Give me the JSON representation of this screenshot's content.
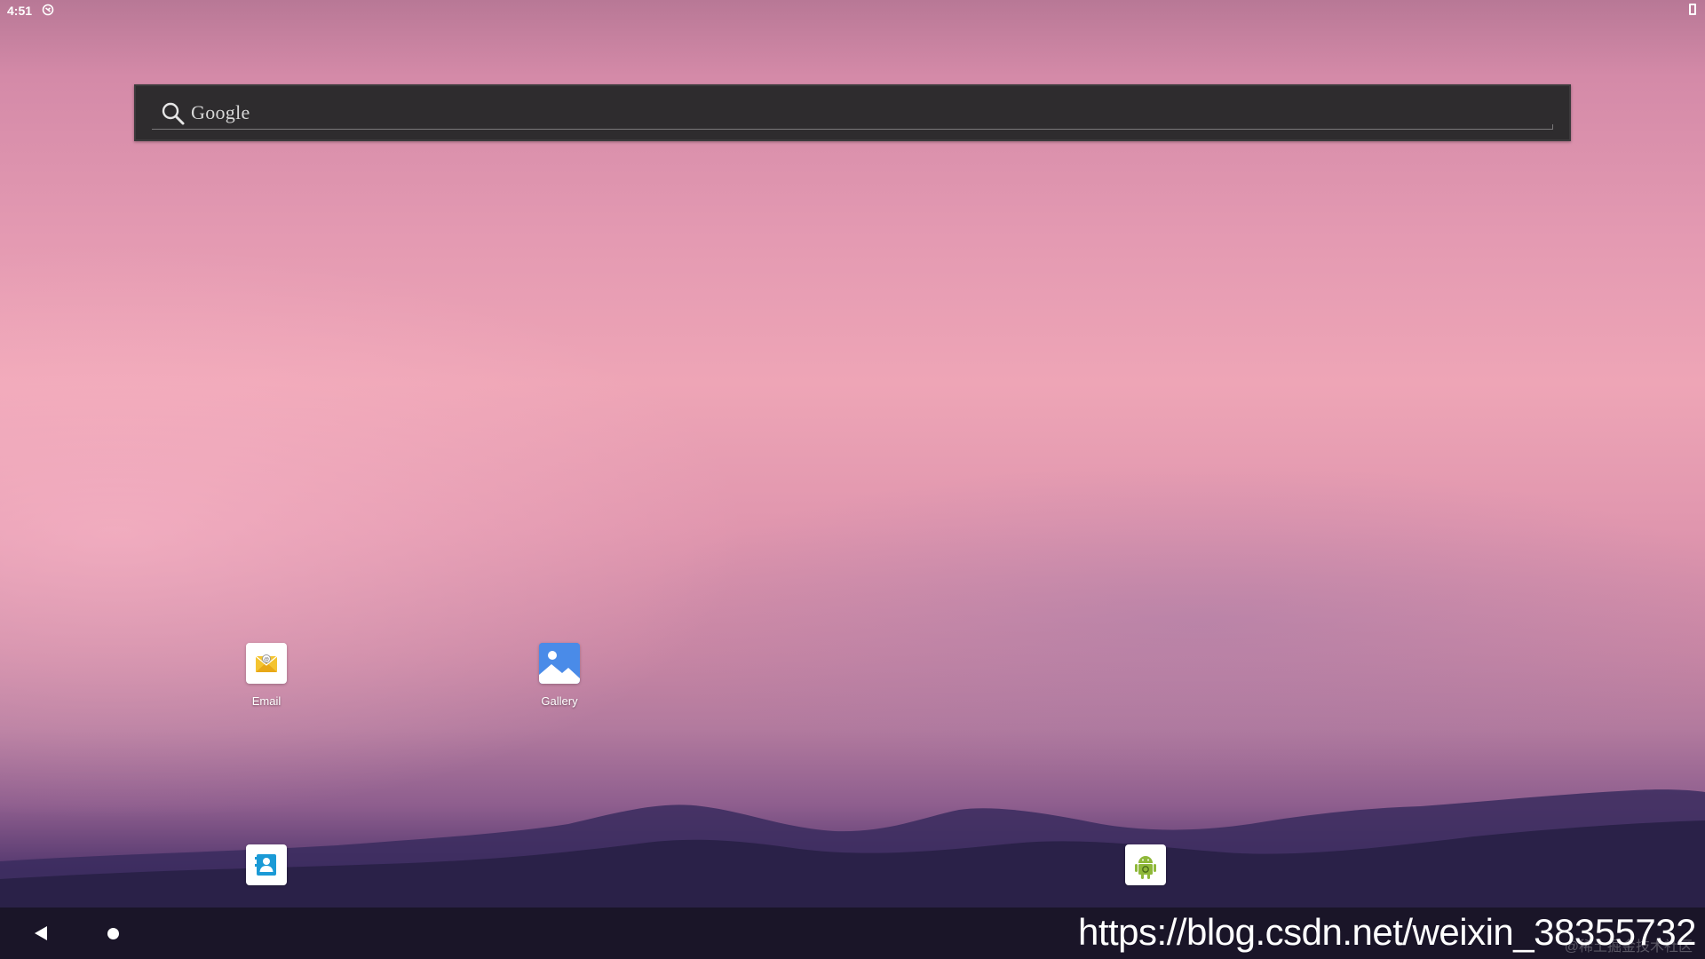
{
  "status_bar": {
    "time": "4:51",
    "sync_icon": "sync-icon",
    "battery_icon": "battery-icon"
  },
  "search": {
    "hint": "Google",
    "icon": "search-icon"
  },
  "apps": [
    {
      "label": "Email",
      "icon": "email-icon",
      "accent": "#f4c430"
    },
    {
      "label": "Gallery",
      "icon": "gallery-icon",
      "accent": "#4a8be8"
    },
    {
      "label": "",
      "icon": "contacts-icon",
      "accent": "#1a9ad6"
    },
    {
      "label": "",
      "icon": "android-app-icon",
      "accent": "#8fb83a"
    }
  ],
  "nav_bar": {
    "back_icon": "back-icon",
    "home_icon": "home-icon"
  },
  "watermark": {
    "url": "https://blog.csdn.net/weixin_38355732",
    "sub": "@稀土掘金技术社区"
  },
  "colors": {
    "sky_top": "#b87896",
    "sky_mid": "#eea5b6",
    "mountain": "#2a2148",
    "nav_bar": "#1a1528"
  }
}
